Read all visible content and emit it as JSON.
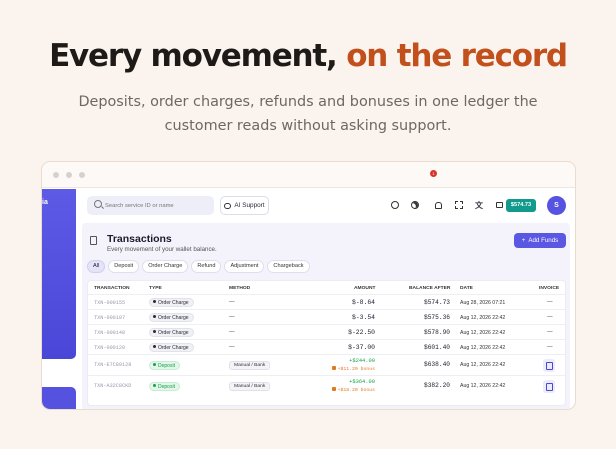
{
  "hero": {
    "title_main": "Every movement,",
    "title_accent": "on the record",
    "subtitle": "Deposits, order charges, refunds and bonuses in one ledger the customer reads without asking support."
  },
  "topbar": {
    "search_placeholder": "Search service ID or name",
    "ai_support_label": "AI Support",
    "notification_count": "1",
    "balance": "$574.73",
    "avatar_initial": "S"
  },
  "sidebar": {
    "logo_text": "ia"
  },
  "page": {
    "title": "Transactions",
    "subtitle": "Every movement of your wallet balance.",
    "add_funds_label": "Add Funds"
  },
  "filters": [
    "All",
    "Deposit",
    "Order Charge",
    "Refund",
    "Adjustment",
    "Chargeback"
  ],
  "table": {
    "headers": {
      "transaction": "TRANSACTION",
      "type": "TYPE",
      "method": "METHOD",
      "amount": "AMOUNT",
      "balance_after": "BALANCE AFTER",
      "date": "DATE",
      "invoice": "INVOICE"
    },
    "rows": [
      {
        "id": "TXN-000155",
        "type": "Order Charge",
        "method": "—",
        "amount": "$-8.64",
        "bonus": "",
        "balance": "$574.73",
        "date": "Aug 28, 2026 07:21",
        "invoice": "—"
      },
      {
        "id": "TXN-000107",
        "type": "Order Charge",
        "method": "—",
        "amount": "$-3.54",
        "bonus": "",
        "balance": "$575.36",
        "date": "Aug 12, 2026 22:42",
        "invoice": "—"
      },
      {
        "id": "TXN-000148",
        "type": "Order Charge",
        "method": "—",
        "amount": "$-22.50",
        "bonus": "",
        "balance": "$578.90",
        "date": "Aug 12, 2026 22:42",
        "invoice": "—"
      },
      {
        "id": "TXN-000120",
        "type": "Order Charge",
        "method": "—",
        "amount": "$-37.00",
        "bonus": "",
        "balance": "$601.40",
        "date": "Aug 12, 2026 22:42",
        "invoice": "—"
      },
      {
        "id": "TXN-E7C89128",
        "type": "Deposit",
        "method": "Manual / Bank",
        "amount": "+$244.00",
        "bonus": "+$11.20 bonus",
        "balance": "$638.40",
        "date": "Aug 12, 2026 22:42",
        "invoice": "icon"
      },
      {
        "id": "TXN-A32C8CKD",
        "type": "Deposit",
        "method": "Manual / Bank",
        "amount": "+$364.00",
        "bonus": "+$18.20 bonus",
        "balance": "$382.20",
        "date": "Aug 12, 2026 22:42",
        "invoice": "icon"
      }
    ]
  },
  "colors": {
    "accent": "#c2501c",
    "primary": "#5a57e3",
    "teal": "#129b8c",
    "positive": "#17a34a",
    "bonus": "#e07a20"
  }
}
